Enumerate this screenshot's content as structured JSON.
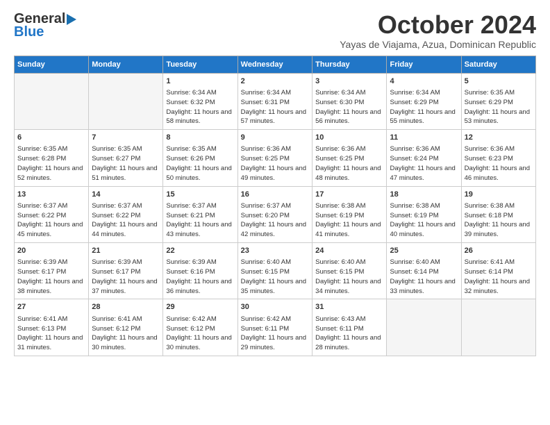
{
  "header": {
    "logo_line1": "General",
    "logo_line2": "Blue",
    "month": "October 2024",
    "location": "Yayas de Viajama, Azua, Dominican Republic"
  },
  "days_header": [
    "Sunday",
    "Monday",
    "Tuesday",
    "Wednesday",
    "Thursday",
    "Friday",
    "Saturday"
  ],
  "weeks": [
    [
      {
        "day": "",
        "text": ""
      },
      {
        "day": "",
        "text": ""
      },
      {
        "day": "1",
        "text": "Sunrise: 6:34 AM\nSunset: 6:32 PM\nDaylight: 11 hours and 58 minutes."
      },
      {
        "day": "2",
        "text": "Sunrise: 6:34 AM\nSunset: 6:31 PM\nDaylight: 11 hours and 57 minutes."
      },
      {
        "day": "3",
        "text": "Sunrise: 6:34 AM\nSunset: 6:30 PM\nDaylight: 11 hours and 56 minutes."
      },
      {
        "day": "4",
        "text": "Sunrise: 6:34 AM\nSunset: 6:29 PM\nDaylight: 11 hours and 55 minutes."
      },
      {
        "day": "5",
        "text": "Sunrise: 6:35 AM\nSunset: 6:29 PM\nDaylight: 11 hours and 53 minutes."
      }
    ],
    [
      {
        "day": "6",
        "text": "Sunrise: 6:35 AM\nSunset: 6:28 PM\nDaylight: 11 hours and 52 minutes."
      },
      {
        "day": "7",
        "text": "Sunrise: 6:35 AM\nSunset: 6:27 PM\nDaylight: 11 hours and 51 minutes."
      },
      {
        "day": "8",
        "text": "Sunrise: 6:35 AM\nSunset: 6:26 PM\nDaylight: 11 hours and 50 minutes."
      },
      {
        "day": "9",
        "text": "Sunrise: 6:36 AM\nSunset: 6:25 PM\nDaylight: 11 hours and 49 minutes."
      },
      {
        "day": "10",
        "text": "Sunrise: 6:36 AM\nSunset: 6:25 PM\nDaylight: 11 hours and 48 minutes."
      },
      {
        "day": "11",
        "text": "Sunrise: 6:36 AM\nSunset: 6:24 PM\nDaylight: 11 hours and 47 minutes."
      },
      {
        "day": "12",
        "text": "Sunrise: 6:36 AM\nSunset: 6:23 PM\nDaylight: 11 hours and 46 minutes."
      }
    ],
    [
      {
        "day": "13",
        "text": "Sunrise: 6:37 AM\nSunset: 6:22 PM\nDaylight: 11 hours and 45 minutes."
      },
      {
        "day": "14",
        "text": "Sunrise: 6:37 AM\nSunset: 6:22 PM\nDaylight: 11 hours and 44 minutes."
      },
      {
        "day": "15",
        "text": "Sunrise: 6:37 AM\nSunset: 6:21 PM\nDaylight: 11 hours and 43 minutes."
      },
      {
        "day": "16",
        "text": "Sunrise: 6:37 AM\nSunset: 6:20 PM\nDaylight: 11 hours and 42 minutes."
      },
      {
        "day": "17",
        "text": "Sunrise: 6:38 AM\nSunset: 6:19 PM\nDaylight: 11 hours and 41 minutes."
      },
      {
        "day": "18",
        "text": "Sunrise: 6:38 AM\nSunset: 6:19 PM\nDaylight: 11 hours and 40 minutes."
      },
      {
        "day": "19",
        "text": "Sunrise: 6:38 AM\nSunset: 6:18 PM\nDaylight: 11 hours and 39 minutes."
      }
    ],
    [
      {
        "day": "20",
        "text": "Sunrise: 6:39 AM\nSunset: 6:17 PM\nDaylight: 11 hours and 38 minutes."
      },
      {
        "day": "21",
        "text": "Sunrise: 6:39 AM\nSunset: 6:17 PM\nDaylight: 11 hours and 37 minutes."
      },
      {
        "day": "22",
        "text": "Sunrise: 6:39 AM\nSunset: 6:16 PM\nDaylight: 11 hours and 36 minutes."
      },
      {
        "day": "23",
        "text": "Sunrise: 6:40 AM\nSunset: 6:15 PM\nDaylight: 11 hours and 35 minutes."
      },
      {
        "day": "24",
        "text": "Sunrise: 6:40 AM\nSunset: 6:15 PM\nDaylight: 11 hours and 34 minutes."
      },
      {
        "day": "25",
        "text": "Sunrise: 6:40 AM\nSunset: 6:14 PM\nDaylight: 11 hours and 33 minutes."
      },
      {
        "day": "26",
        "text": "Sunrise: 6:41 AM\nSunset: 6:14 PM\nDaylight: 11 hours and 32 minutes."
      }
    ],
    [
      {
        "day": "27",
        "text": "Sunrise: 6:41 AM\nSunset: 6:13 PM\nDaylight: 11 hours and 31 minutes."
      },
      {
        "day": "28",
        "text": "Sunrise: 6:41 AM\nSunset: 6:12 PM\nDaylight: 11 hours and 30 minutes."
      },
      {
        "day": "29",
        "text": "Sunrise: 6:42 AM\nSunset: 6:12 PM\nDaylight: 11 hours and 30 minutes."
      },
      {
        "day": "30",
        "text": "Sunrise: 6:42 AM\nSunset: 6:11 PM\nDaylight: 11 hours and 29 minutes."
      },
      {
        "day": "31",
        "text": "Sunrise: 6:43 AM\nSunset: 6:11 PM\nDaylight: 11 hours and 28 minutes."
      },
      {
        "day": "",
        "text": ""
      },
      {
        "day": "",
        "text": ""
      }
    ]
  ]
}
